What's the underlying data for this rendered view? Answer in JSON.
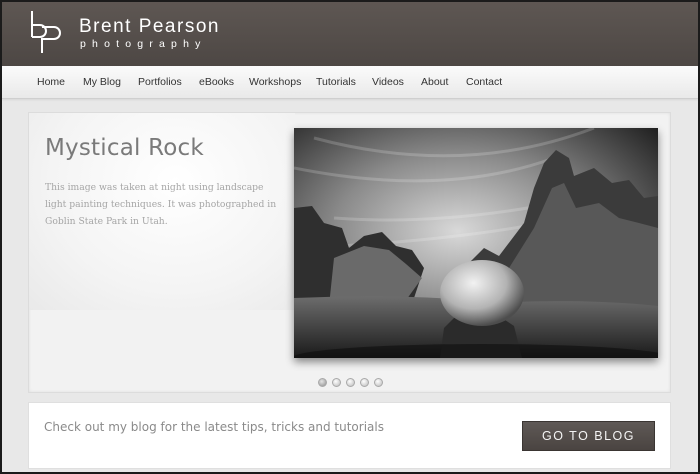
{
  "header": {
    "brand_name": "Brent Pearson",
    "brand_tagline": "photography",
    "logo_icon": "bp-monogram-icon"
  },
  "nav": {
    "items": [
      {
        "label": "Home"
      },
      {
        "label": "My Blog"
      },
      {
        "label": "Portfolios"
      },
      {
        "label": "eBooks"
      },
      {
        "label": "Workshops"
      },
      {
        "label": "Tutorials"
      },
      {
        "label": "Videos"
      },
      {
        "label": "About"
      },
      {
        "label": "Contact"
      }
    ]
  },
  "slider": {
    "title": "Mystical Rock",
    "description": "This image was taken at night using landscape light painting techniques. It was photographed in Goblin State Park in Utah.",
    "photo_subject": "black-and-white rock formation at night",
    "dot_count": 5,
    "active_dot": 1
  },
  "blog_cta": {
    "text": "Check out my blog for the latest tips, tricks and tutorials",
    "button_label": "GO TO BLOG"
  },
  "colors": {
    "header_bg": "#534c49",
    "nav_bg": "#f4f4f4",
    "page_bg": "#e8e8e8",
    "button_bg": "#544e4b",
    "title_text": "#7a7a7a"
  }
}
